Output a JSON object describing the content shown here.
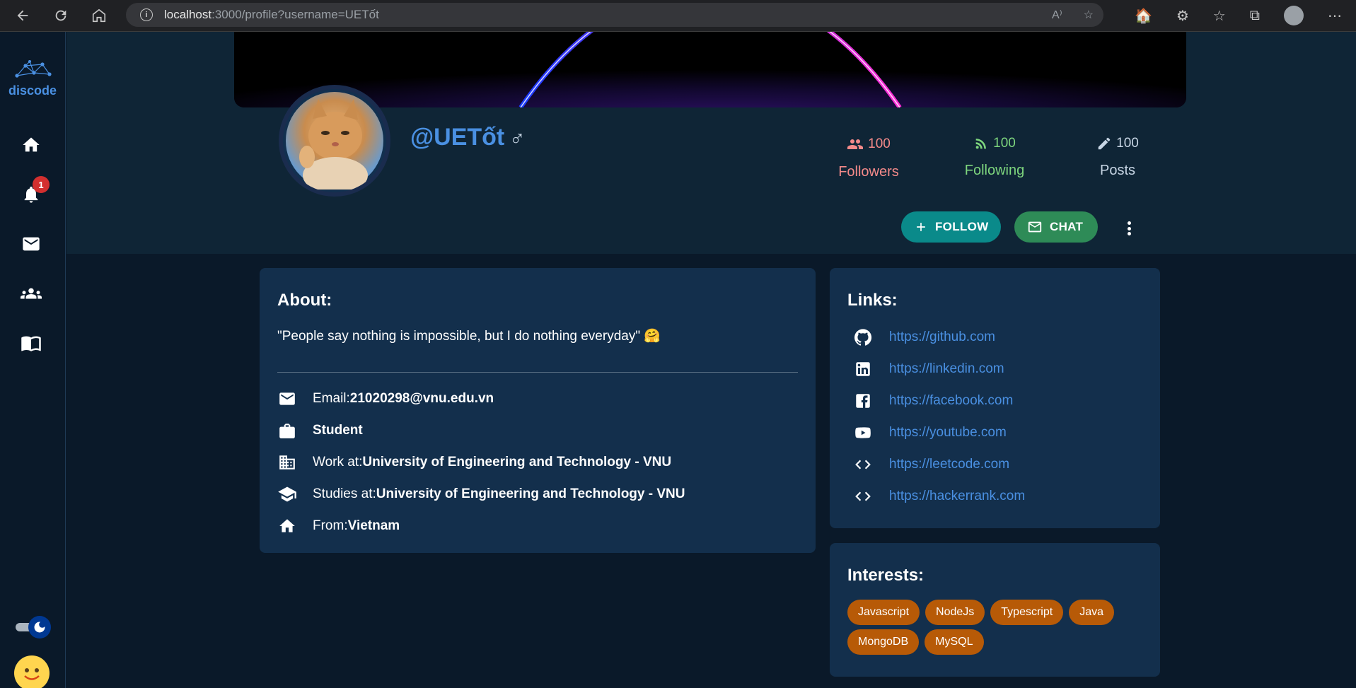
{
  "browser": {
    "url_host": "localhost",
    "url_path": ":3000/profile?username=UETốt",
    "read_aloud_icon": "A⁾"
  },
  "sidebar": {
    "logo_text": "discode",
    "notification_count": "1"
  },
  "profile": {
    "username": "@UETốt",
    "gender_symbol": "♂",
    "stats": {
      "followers_count": "100",
      "followers_label": "Followers",
      "following_count": "100",
      "following_label": "Following",
      "posts_count": "100",
      "posts_label": "Posts"
    },
    "follow_label": "FOLLOW",
    "chat_label": "CHAT"
  },
  "about": {
    "title": "About:",
    "quote": "\"People say nothing is impossible, but I do nothing everyday\" 🤗",
    "email_label": "Email: ",
    "email_value": "21020298@vnu.edu.vn",
    "occupation": "Student",
    "work_label": "Work at: ",
    "work_value": "University of Engineering and Technology - VNU",
    "study_label": "Studies at: ",
    "study_value": "University of Engineering and Technology - VNU",
    "from_label": "From: ",
    "from_value": "Vietnam"
  },
  "links": {
    "title": "Links:",
    "items": [
      {
        "icon": "github-icon",
        "url": "https://github.com"
      },
      {
        "icon": "linkedin-icon",
        "url": "https://linkedin.com"
      },
      {
        "icon": "facebook-icon",
        "url": "https://facebook.com"
      },
      {
        "icon": "youtube-icon",
        "url": "https://youtube.com"
      },
      {
        "icon": "code-icon",
        "url": "https://leetcode.com"
      },
      {
        "icon": "code-icon",
        "url": "https://hackerrank.com"
      }
    ]
  },
  "interests": {
    "title": "Interests:",
    "tags": [
      "Javascript",
      "NodeJs",
      "Typescript",
      "Java",
      "MongoDB",
      "MySQL"
    ]
  },
  "colors": {
    "background": "#0a1929",
    "card": "#132f4c",
    "accent_blue": "#4a90e2",
    "followers": "#f48a8a",
    "following": "#7ed67e",
    "posts": "#c8d6e5",
    "follow_button": "#0a8a8a",
    "chat_button": "#2e8b57",
    "chip": "#b75a07"
  }
}
